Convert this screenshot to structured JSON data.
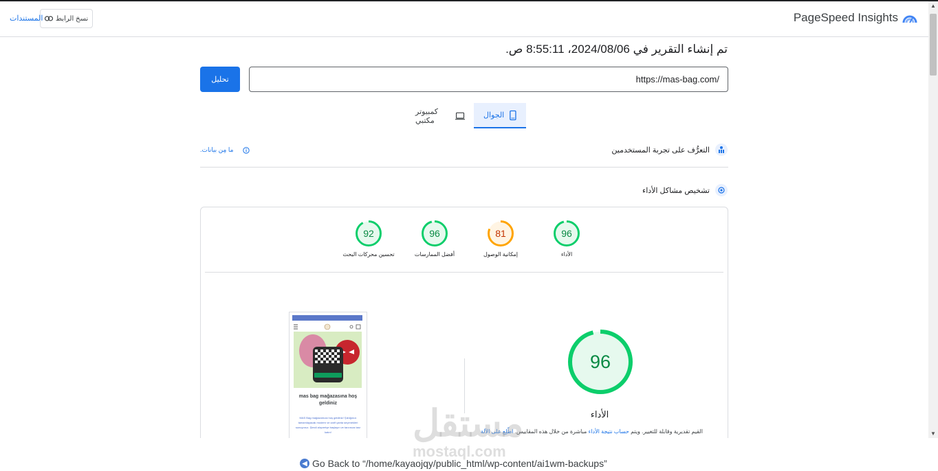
{
  "header": {
    "brand_title": "PageSpeed Insights",
    "copy_link_label": "نسخ الرابط",
    "docs_label": "المستندات"
  },
  "report": {
    "date_text": "تم إنشاء التقرير في 2024/08/06، 8:55:11 ص."
  },
  "search": {
    "url_value": "https://mas-bag.com/",
    "analyze_label": "تحليل"
  },
  "device_tabs": [
    {
      "label": "الجوال",
      "active": true
    },
    {
      "label": "كمبيوتر مكتبي",
      "active": false
    }
  ],
  "crux": {
    "title": "التعرُّف على تجربة المستخدمين",
    "no_data_label": "ما مِن بيانات."
  },
  "diagnostics": {
    "title": "تشخيص مشاكل الأداء"
  },
  "scores": [
    {
      "label": "الأداء",
      "value": 96,
      "color": "#0cce6b"
    },
    {
      "label": "إمكانية الوصول",
      "value": 81,
      "color": "#ffa400"
    },
    {
      "label": "أفضل الممارسات",
      "value": 96,
      "color": "#0cce6b"
    },
    {
      "label": "تحسين محركات البحث",
      "value": 92,
      "color": "#0cce6b"
    }
  ],
  "main_score": {
    "value": 96,
    "label": "الأداء",
    "desc_prefix": "القيم تقديرية وقابلة للتغيير. ويتم",
    "desc_link1": "حساب نتيجة الأداء",
    "desc_middle": "مباشرة من خلال هذه المقاييس.",
    "desc_link2": "اطّلِع على الآلة"
  },
  "screenshot": {
    "heading": "mas bag mağazasına hoş geldiniz",
    "body": "MAS Bag mağazamıza hoş geldiniz! Şıklığınızı tamamlayacak modern ve zarif çanta seçenekleri sunuyoruz. Şimdi alışverişe başlayın ve tarzınıza tarz katın!"
  },
  "watermark": {
    "main": "مستقل",
    "sub": "mostaql.com"
  },
  "footer": {
    "go_back": "Go Back to “/home/kayaojqy/public_html/wp-content/ai1wm-backups”"
  }
}
